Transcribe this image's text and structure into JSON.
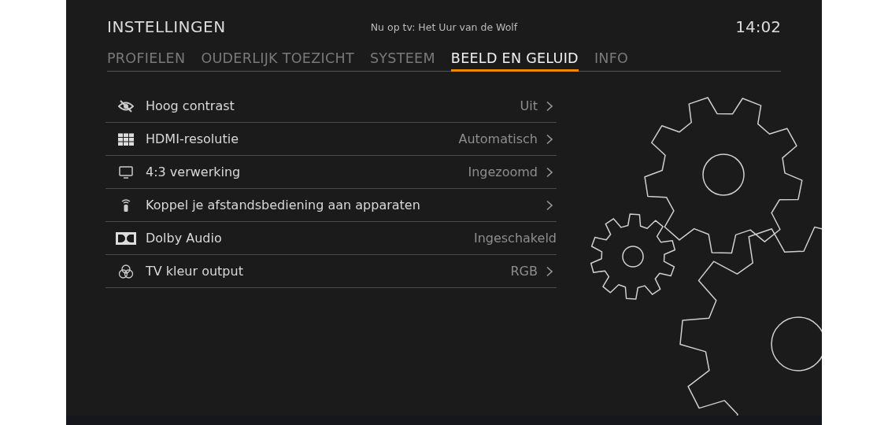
{
  "header": {
    "title": "INSTELLINGEN",
    "now_playing": "Nu op tv: Het Uur van de Wolf",
    "clock": "14:02"
  },
  "tabs": [
    {
      "label": "PROFIELEN",
      "selected": false
    },
    {
      "label": "OUDERLIJK TOEZICHT",
      "selected": false
    },
    {
      "label": "SYSTEEM",
      "selected": false
    },
    {
      "label": "BEELD EN GELUID",
      "selected": true
    },
    {
      "label": "INFO",
      "selected": false
    }
  ],
  "settings": [
    {
      "kind": "eye-off",
      "label": "Hoog contrast",
      "value": "Uit",
      "chevron": true
    },
    {
      "kind": "grid",
      "label": "HDMI-resolutie",
      "value": "Automatisch",
      "chevron": true
    },
    {
      "kind": "monitor",
      "label": "4:3 verwerking",
      "value": "Ingezoomd",
      "chevron": true
    },
    {
      "kind": "remote",
      "label": "Koppel je afstandsbediening aan apparaten",
      "chevron": true
    },
    {
      "kind": "dolby",
      "label": "Dolby Audio",
      "value": "Ingeschakeld",
      "chevron": false
    },
    {
      "kind": "color",
      "label": "TV kleur output",
      "value": "RGB",
      "chevron": true
    }
  ]
}
